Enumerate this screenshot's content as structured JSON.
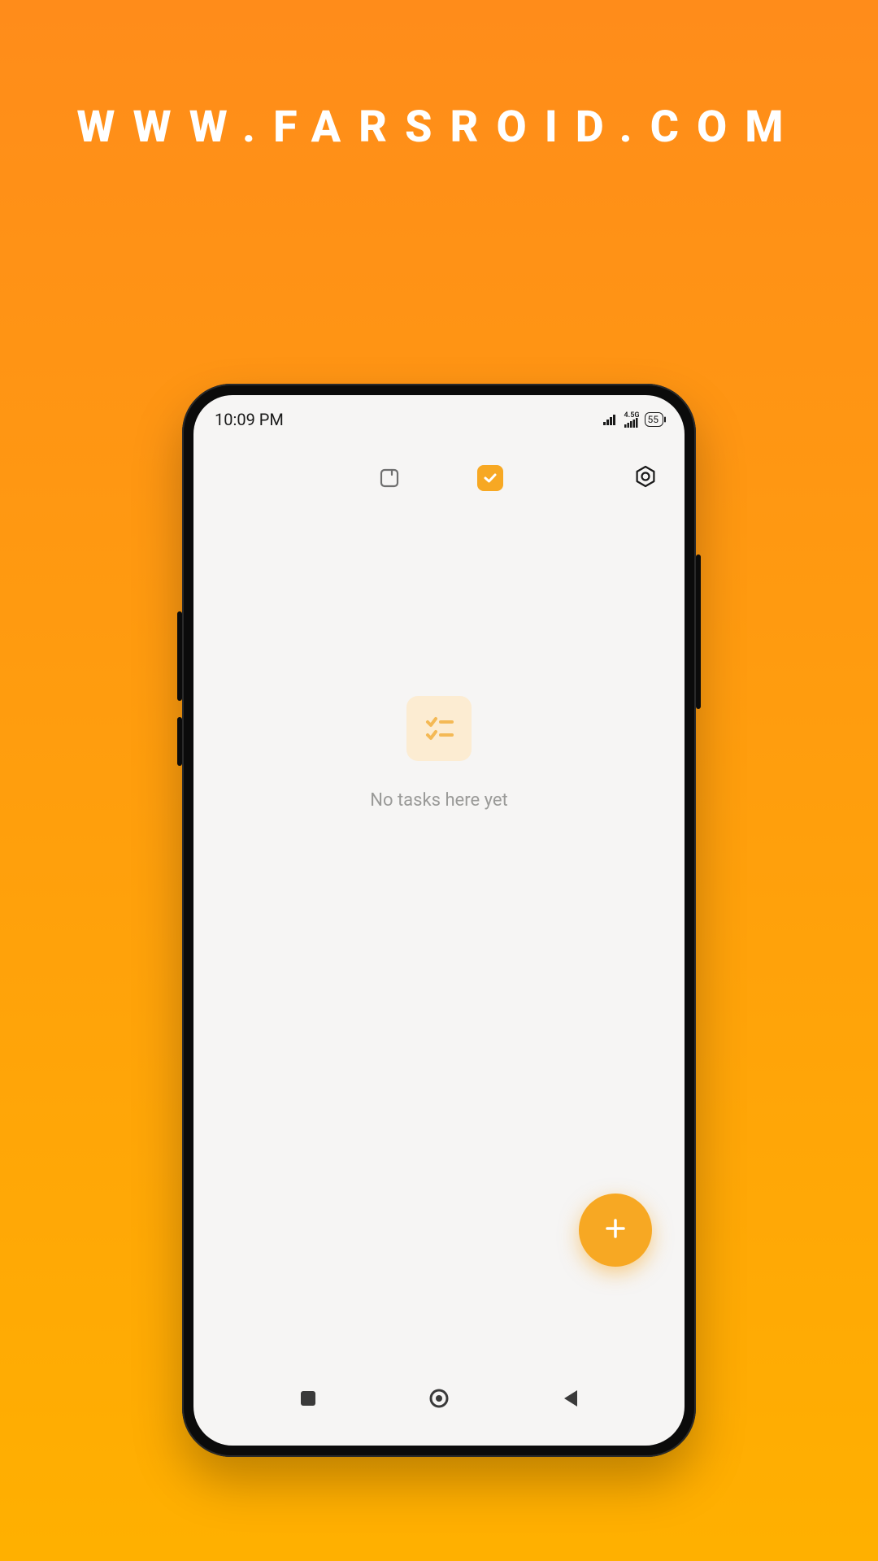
{
  "watermark": "WWW.FARSROID.COM",
  "statusBar": {
    "time": "10:09 PM",
    "networkLabel": "4.5G",
    "battery": "55"
  },
  "tabs": {
    "notes": "notes",
    "tasks": "tasks"
  },
  "emptyState": {
    "text": "No tasks here yet"
  },
  "colors": {
    "accent": "#f7a823",
    "bgGradientTop": "#ff8c1a",
    "bgGradientBottom": "#ffb000"
  }
}
